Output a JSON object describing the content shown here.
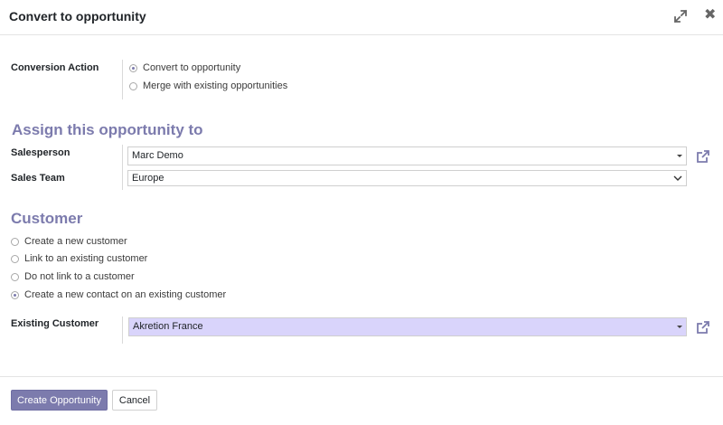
{
  "dialog": {
    "title": "Convert to opportunity"
  },
  "conversion": {
    "label": "Conversion Action",
    "options": [
      {
        "label": "Convert to opportunity",
        "checked": true
      },
      {
        "label": "Merge with existing opportunities",
        "checked": false
      }
    ]
  },
  "assign": {
    "title": "Assign this opportunity to",
    "salesperson_label": "Salesperson",
    "salesperson_value": "Marc Demo",
    "sales_team_label": "Sales Team",
    "sales_team_value": "Europe"
  },
  "customer": {
    "title": "Customer",
    "options": [
      {
        "label": "Create a new customer",
        "checked": false
      },
      {
        "label": "Link to an existing customer",
        "checked": false
      },
      {
        "label": "Do not link to a customer",
        "checked": false
      },
      {
        "label": "Create a new contact on an existing customer",
        "checked": true
      }
    ],
    "existing_label": "Existing Customer",
    "existing_value": "Akretion France"
  },
  "footer": {
    "primary_label": "Create Opportunity",
    "secondary_label": "Cancel"
  },
  "colors": {
    "accent": "#7c7bad",
    "highlight_field": "#d9d4fb"
  },
  "icons": {
    "expand": "expand-icon",
    "close": "close-icon",
    "external_link": "external-link-icon"
  }
}
